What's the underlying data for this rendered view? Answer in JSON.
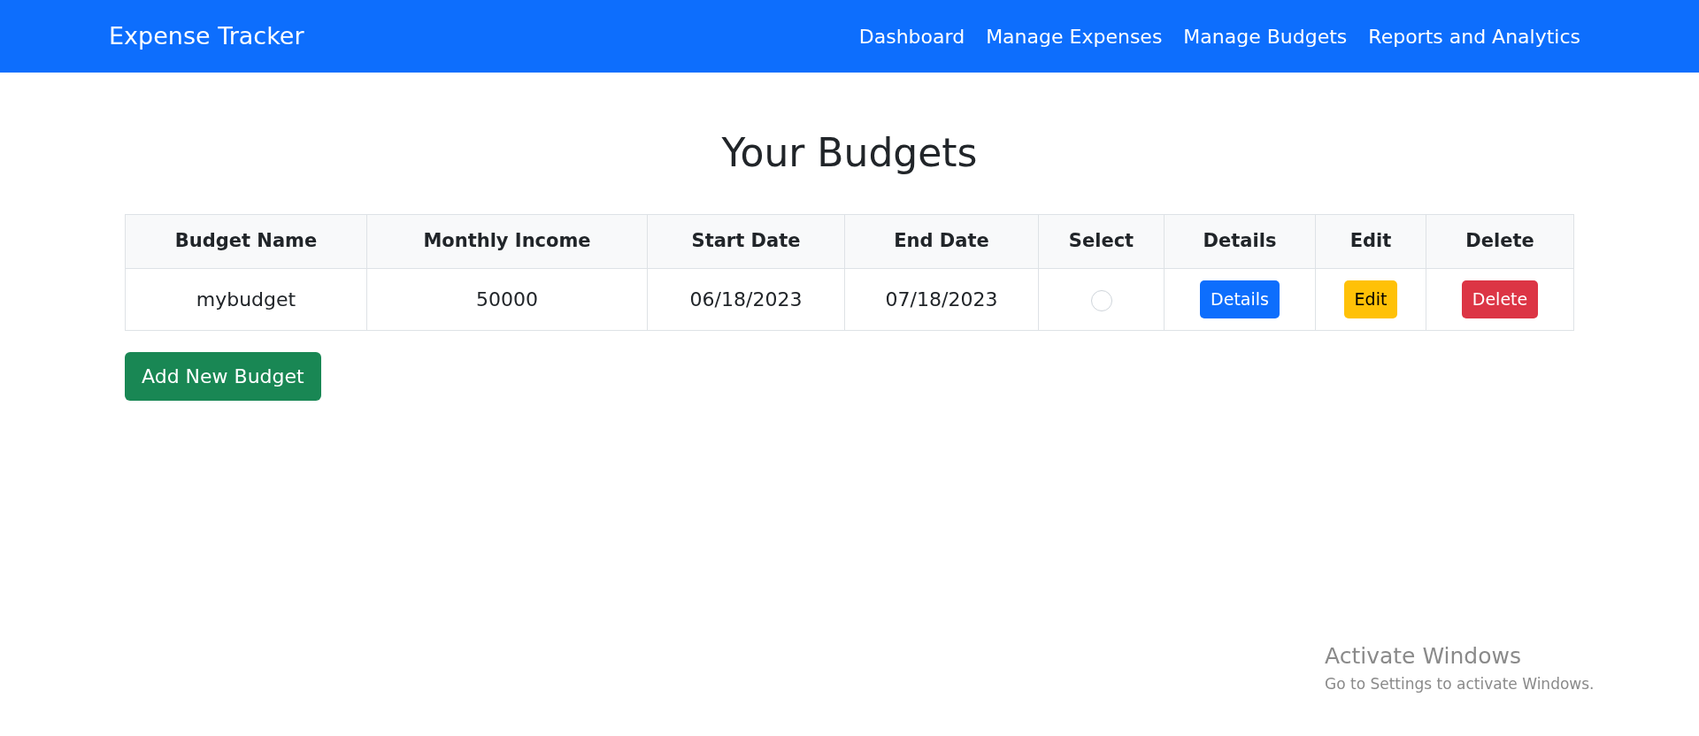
{
  "navbar": {
    "brand": "Expense Tracker",
    "links": [
      "Dashboard",
      "Manage Expenses",
      "Manage Budgets",
      "Reports and Analytics"
    ]
  },
  "page_title": "Your Budgets",
  "table": {
    "columns": [
      "Budget Name",
      "Monthly Income",
      "Start Date",
      "End Date",
      "Select",
      "Details",
      "Edit",
      "Delete"
    ],
    "rows": [
      {
        "name": "mybudget",
        "income": "50000",
        "start": "06/18/2023",
        "end": "07/18/2023",
        "selected": false,
        "actions": [
          {
            "kind": "details",
            "label": "Details"
          },
          {
            "kind": "edit",
            "label": "Edit"
          },
          {
            "kind": "delete",
            "label": "Delete"
          }
        ]
      }
    ]
  },
  "add_button": "Add New Budget",
  "os_notice": {
    "title": "Activate Windows",
    "subtitle": "Go to Settings to activate Windows."
  }
}
